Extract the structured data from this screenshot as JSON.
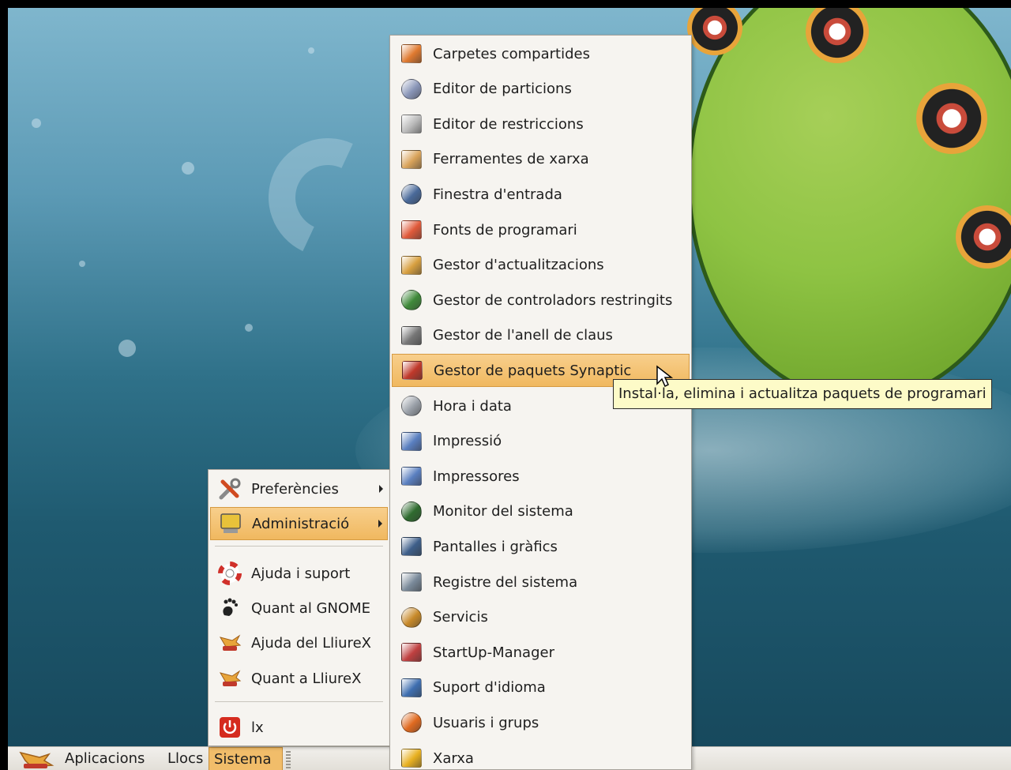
{
  "panel": {
    "menus": [
      {
        "label": "Aplicacions"
      },
      {
        "label": "Llocs"
      },
      {
        "label": "Sistema"
      }
    ]
  },
  "system_menu": {
    "items": [
      {
        "label": "Preferències",
        "icon": "preferences-icon",
        "submenu": true
      },
      {
        "label": "Administració",
        "icon": "administration-icon",
        "submenu": true
      },
      {
        "label": "Ajuda i suport",
        "icon": "help-icon"
      },
      {
        "label": "Quant al GNOME",
        "icon": "gnome-foot-icon"
      },
      {
        "label": "Ajuda del LliureX",
        "icon": "lliurex-icon"
      },
      {
        "label": "Quant a LliureX",
        "icon": "lliurex-icon"
      },
      {
        "label": "lx",
        "icon": "power-icon"
      }
    ]
  },
  "admin_menu": {
    "items": [
      {
        "label": "Carpetes compartides",
        "icon": "shared-folder-icon",
        "color": "#e07a30"
      },
      {
        "label": "Editor de particions",
        "icon": "partition-editor-icon",
        "color": "#8a96b8"
      },
      {
        "label": "Editor de restriccions",
        "icon": "shield-icon",
        "color": "#b9b9b9"
      },
      {
        "label": "Ferramentes de xarxa",
        "icon": "network-tools-icon",
        "color": "#d9a35a"
      },
      {
        "label": "Finestra d'entrada",
        "icon": "login-window-icon",
        "color": "#4a6a9a"
      },
      {
        "label": "Fonts de programari",
        "icon": "software-sources-icon",
        "color": "#e05a3a"
      },
      {
        "label": "Gestor d'actualitzacions",
        "icon": "update-manager-icon",
        "color": "#d8a040"
      },
      {
        "label": "Gestor de controladors restringits",
        "icon": "hardware-drivers-icon",
        "color": "#3f8a3a"
      },
      {
        "label": "Gestor de l'anell de claus",
        "icon": "keyring-icon",
        "color": "#777777"
      },
      {
        "label": "Gestor de paquets Synaptic",
        "icon": "synaptic-icon",
        "color": "#c0392b"
      },
      {
        "label": "Hora i data",
        "icon": "clock-icon",
        "color": "#9aa0a8"
      },
      {
        "label": "Impressió",
        "icon": "printer-icon",
        "color": "#5a7fc0"
      },
      {
        "label": "Impressores",
        "icon": "printer-icon",
        "color": "#5a7fc0"
      },
      {
        "label": "Monitor del sistema",
        "icon": "system-monitor-icon",
        "color": "#2f6b2f"
      },
      {
        "label": "Pantalles i gràfics",
        "icon": "display-icon",
        "color": "#3e5f8a"
      },
      {
        "label": "Registre del sistema",
        "icon": "log-viewer-icon",
        "color": "#7a8a9a"
      },
      {
        "label": "Servicis",
        "icon": "services-icon",
        "color": "#c88a2a"
      },
      {
        "label": "StartUp-Manager",
        "icon": "startup-manager-icon",
        "color": "#c04040"
      },
      {
        "label": "Suport d'idioma",
        "icon": "language-icon",
        "color": "#3f6fb0"
      },
      {
        "label": "Usuaris i grups",
        "icon": "users-icon",
        "color": "#e06a20"
      },
      {
        "label": "Xarxa",
        "icon": "network-icon",
        "color": "#e8b020"
      }
    ],
    "highlighted_index": 9
  },
  "tooltip": {
    "text": "Instal·la, elimina i actualitza paquets de programari"
  }
}
